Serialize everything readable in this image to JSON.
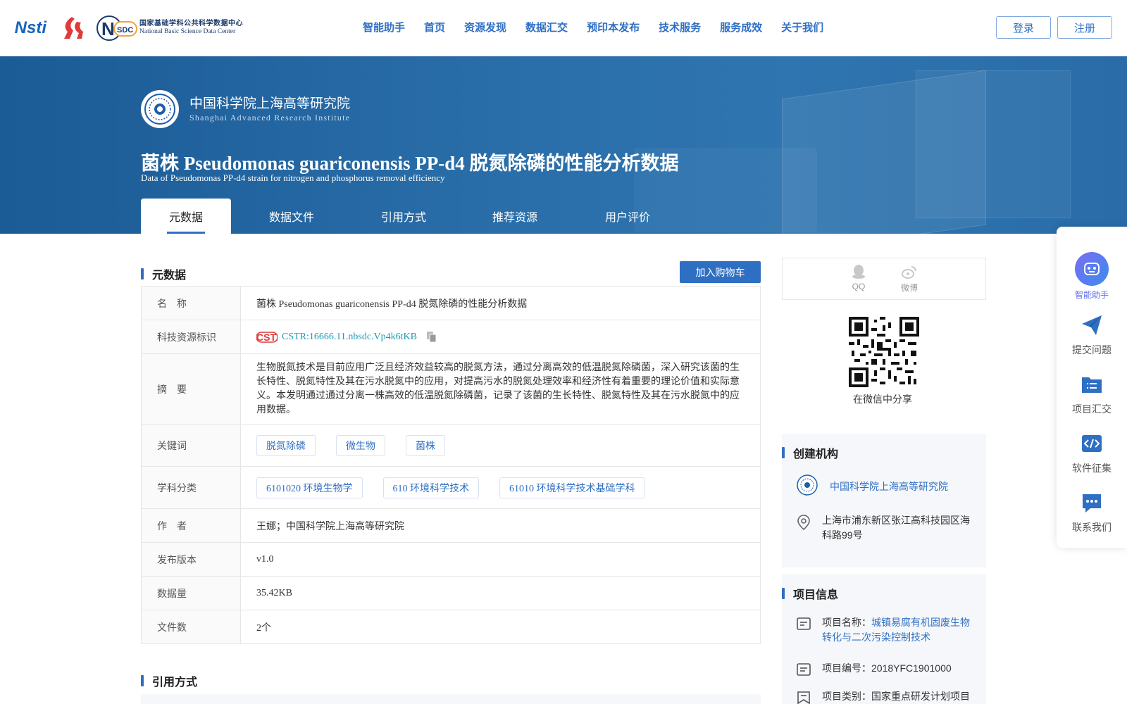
{
  "header": {
    "logo_nsti": "Nsti",
    "logo_nsdc_cn": "国家基础学科公共科学数据中心",
    "logo_nsdc_en": "National Basic Science Data Center",
    "logo_nsdc_mark": "NSDC",
    "nav": [
      "智能助手",
      "首页",
      "资源发现",
      "数据汇交",
      "预印本发布",
      "技术服务",
      "服务成效",
      "关于我们"
    ],
    "login": "登录",
    "register": "注册"
  },
  "banner": {
    "institute_cn": "中国科学院上海高等研究院",
    "institute_en": "Shanghai Advanced Research Institute",
    "title": "菌株 Pseudomonas guariconensis PP-d4 脱氮除磷的性能分析数据",
    "subtitle": "Data of Pseudomonas PP-d4 strain for nitrogen and phosphorus removal efficiency",
    "tabs": [
      "元数据",
      "数据文件",
      "引用方式",
      "推荐资源",
      "用户评价"
    ],
    "active_tab": "元数据"
  },
  "metadata": {
    "section_title": "元数据",
    "cart_button": "加入购物车",
    "name_label": "名　称",
    "name_value": "菌株 Pseudomonas guariconensis PP-d4 脱氮除磷的性能分析数据",
    "id_label": "科技资源标识",
    "id_value": "CSTR:16666.11.nbsdc.Vp4k6tKB",
    "cstr_logo": "CSTR",
    "abstract_label": "摘　要",
    "abstract_value": "生物脱氮技术是目前应用广泛且经济效益较高的脱氮方法，通过分离高效的低温脱氮除磷菌，深入研究该菌的生长特性、脱氮特性及其在污水脱氮中的应用，对提高污水的脱氮处理效率和经济性有着重要的理论价值和实际意义。本发明通过通过分离一株高效的低温脱氮除磷菌，记录了该菌的生长特性、脱氮特性及其在污水脱氮中的应用数据。",
    "keywords_label": "关键词",
    "keywords": [
      "脱氮除磷",
      "微生物",
      "菌株"
    ],
    "subject_label": "学科分类",
    "subjects": [
      "6101020 环境生物学",
      "610 环境科学技术",
      "61010 环境科学技术基础学科"
    ],
    "author_label": "作　者",
    "author_value": "王娜；中国科学院上海高等研究院",
    "version_label": "发布版本",
    "version_value": "v1.0",
    "size_label": "数据量",
    "size_value": "35.42KB",
    "files_label": "文件数",
    "files_value": "2个"
  },
  "citation": {
    "section_title": "引用方式"
  },
  "share": {
    "qq": "QQ",
    "weibo": "微博",
    "wechat_caption": "在微信中分享"
  },
  "org": {
    "section_title": "创建机构",
    "name": "中国科学院上海高等研究院",
    "address": "上海市浦东新区张江高科技园区海科路99号"
  },
  "project": {
    "section_title": "项目信息",
    "name_label": "项目名称：",
    "name_value": "城镇易腐有机固废生物转化与二次污染控制技术",
    "code_label": "项目编号：",
    "code_value": "2018YFC1901000",
    "type_label": "项目类别：",
    "type_value": "国家重点研发计划项目"
  },
  "side": [
    "智能助手",
    "提交问题",
    "项目汇交",
    "软件征集",
    "联系我们"
  ],
  "colors": {
    "primary": "#2f6fc3",
    "banner": "#1f639f",
    "cstr": "#1d9cb5",
    "accent_red": "#e03a3a"
  }
}
